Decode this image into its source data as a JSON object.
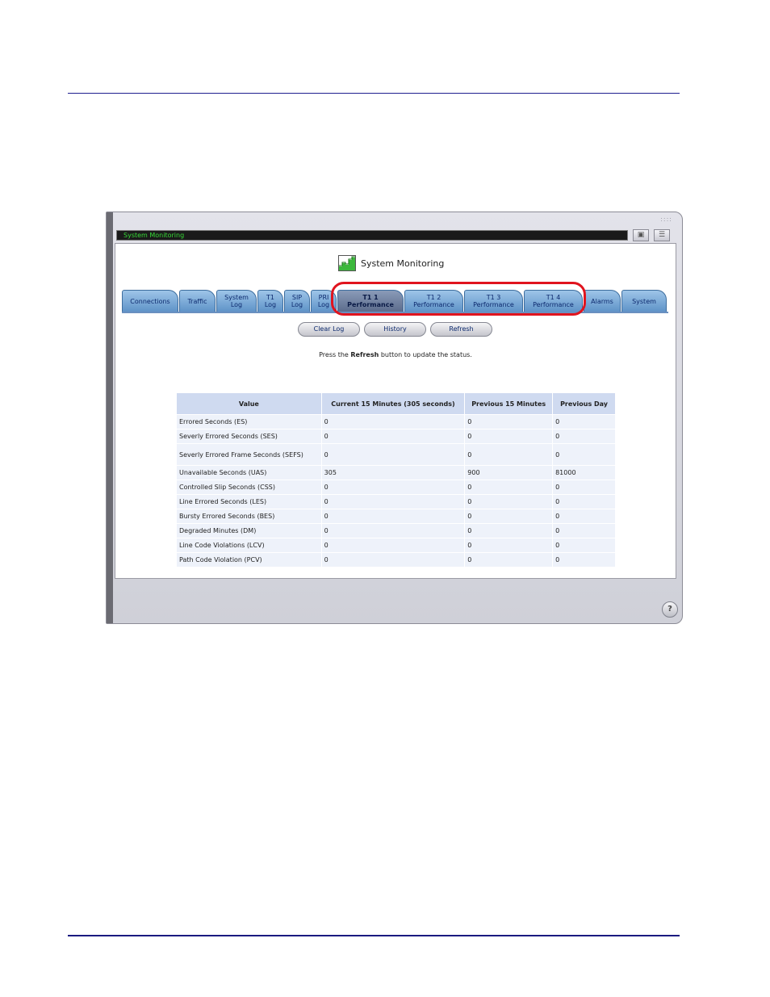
{
  "window": {
    "title": "System Monitoring",
    "grip": "::::"
  },
  "page": {
    "title": "System Monitoring",
    "hint_prefix": "Press the ",
    "hint_bold": "Refresh",
    "hint_suffix": " button to update the status."
  },
  "tabs": [
    {
      "label": "Connections"
    },
    {
      "label": "Traffic"
    },
    {
      "label": "System Log"
    },
    {
      "label": "T1 Log"
    },
    {
      "label": "SIP Log"
    },
    {
      "label": "PRI Log"
    },
    {
      "label": "T1 1 Performance",
      "active": true
    },
    {
      "label": "T1 2 Performance"
    },
    {
      "label": "T1 3 Performance"
    },
    {
      "label": "T1 4 Performance"
    },
    {
      "label": "Alarms"
    },
    {
      "label": "System"
    }
  ],
  "buttons": {
    "clear_log": "Clear Log",
    "history": "History",
    "refresh": "Refresh"
  },
  "table": {
    "headers": [
      "Value",
      "Current 15 Minutes (305 seconds)",
      "Previous 15 Minutes",
      "Previous Day"
    ],
    "rows": [
      [
        "Errored Seconds (ES)",
        "0",
        "0",
        "0"
      ],
      [
        "Severly Errored Seconds (SES)",
        "0",
        "0",
        "0"
      ],
      [
        "Severly Errored Frame Seconds (SEFS)",
        "0",
        "0",
        "0"
      ],
      [
        "Unavailable Seconds (UAS)",
        "305",
        "900",
        "81000"
      ],
      [
        "Controlled Slip Seconds (CSS)",
        "0",
        "0",
        "0"
      ],
      [
        "Line Errored Seconds (LES)",
        "0",
        "0",
        "0"
      ],
      [
        "Bursty Errored Seconds (BES)",
        "0",
        "0",
        "0"
      ],
      [
        "Degraded Minutes (DM)",
        "0",
        "0",
        "0"
      ],
      [
        "Line Code Violations (LCV)",
        "0",
        "0",
        "0"
      ],
      [
        "Path Code Violation (PCV)",
        "0",
        "0",
        "0"
      ]
    ]
  },
  "icons": {
    "page_icon": "monitor-chart-icon",
    "help": "help-icon",
    "title_buttons": [
      "restore-icon",
      "menu-icon"
    ]
  },
  "colors": {
    "tab_blue": "#6f9fd0",
    "tab_active": "#6c7c9c",
    "highlight": "#e0141e",
    "title_text": "#36d936"
  }
}
